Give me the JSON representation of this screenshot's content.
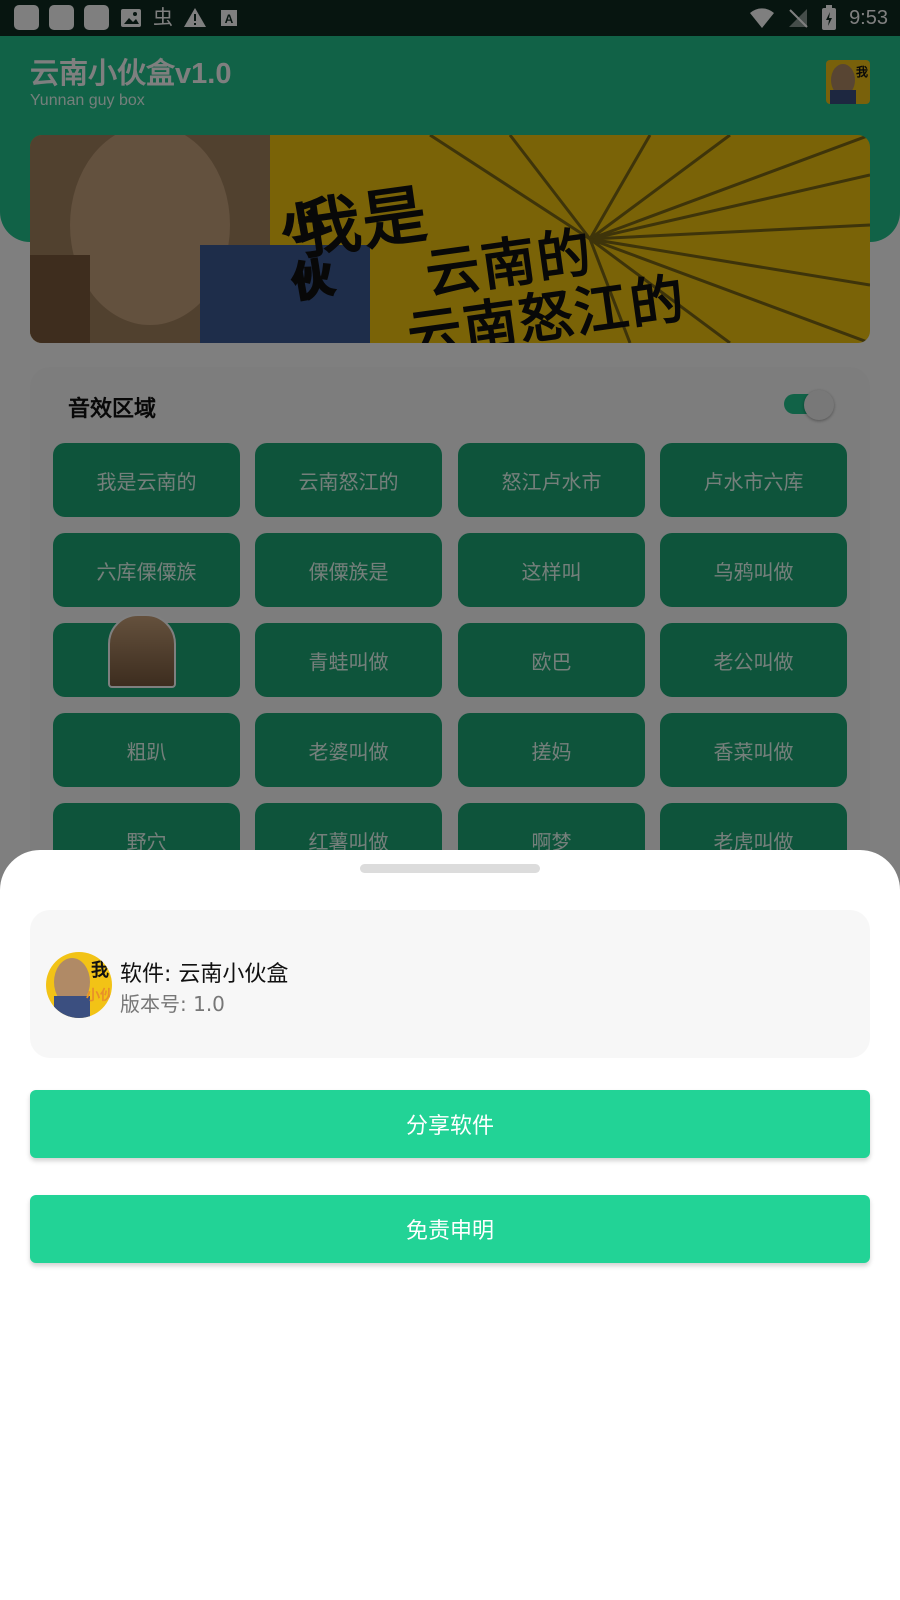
{
  "status_bar": {
    "time": "9:53",
    "left_icons": [
      "notification-square-icon",
      "notification-square-icon",
      "notification-square-icon",
      "image-icon",
      "app-glyph-icon",
      "warning-icon",
      "font-icon"
    ],
    "right_icons": [
      "wifi-icon",
      "no-signal-icon",
      "battery-charging-icon"
    ]
  },
  "app": {
    "title": "云南小伙盒v1.0",
    "subtitle": "Yunnan guy box",
    "banner": {
      "line1": "我是",
      "line2": "云南的",
      "line3": "云南怒江的",
      "badge": "小伙"
    },
    "sound_section": {
      "title": "音效区域",
      "toggle_on": true,
      "buttons": [
        "我是云南的",
        "云南怒江的",
        "怒江卢水市",
        "卢水市六库",
        "六库傈僳族",
        "傈僳族是",
        "这样叫",
        "乌鸦叫做",
        "",
        "青蛙叫做",
        "欧巴",
        "老公叫做",
        "粗趴",
        "老婆叫做",
        "搓妈",
        "香菜叫做",
        "野穴",
        "红薯叫做",
        "啊梦",
        "老虎叫做"
      ]
    }
  },
  "sheet": {
    "app_name": "软件: 云南小伙盒",
    "version": "版本号: 1.0",
    "share_label": "分享软件",
    "disclaimer_label": "免责申明"
  },
  "colors": {
    "accent": "#22d396",
    "header": "#22c48f",
    "button": "#1ca877"
  }
}
